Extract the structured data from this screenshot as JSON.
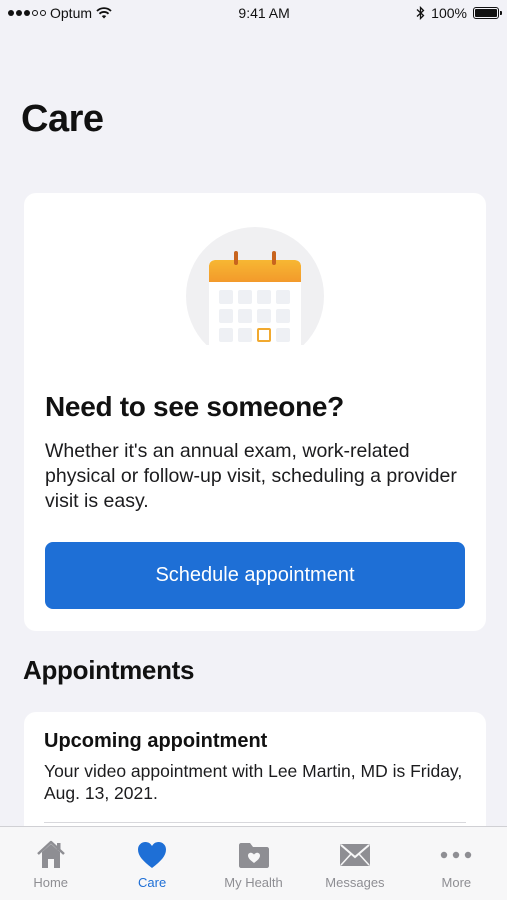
{
  "status_bar": {
    "carrier": "Optum",
    "time": "9:41 AM",
    "battery": "100%"
  },
  "page": {
    "title": "Care"
  },
  "hero": {
    "illustration_icon": "calendar-icon",
    "heading": "Need to see someone?",
    "body": "Whether it's an annual exam, work-related physical or follow-up visit, scheduling a provider visit is easy.",
    "button_label": "Schedule appointment"
  },
  "appointments": {
    "section_title": "Appointments",
    "card_title": "Upcoming appointment",
    "card_body": "Your video appointment with Lee Martin, MD is Friday, Aug. 13, 2021."
  },
  "tab_bar": {
    "items": [
      {
        "label": "Home",
        "icon": "home-icon",
        "active": false
      },
      {
        "label": "Care",
        "icon": "heart-icon",
        "active": true
      },
      {
        "label": "My Health",
        "icon": "folder-heart-icon",
        "active": false
      },
      {
        "label": "Messages",
        "icon": "envelope-icon",
        "active": false
      },
      {
        "label": "More",
        "icon": "ellipsis-icon",
        "active": false
      }
    ]
  },
  "colors": {
    "accent": "#1e6fd6",
    "background": "#f2f2f7",
    "calendar_header": "#f39a2b",
    "inactive_tab": "#8e8e93"
  }
}
